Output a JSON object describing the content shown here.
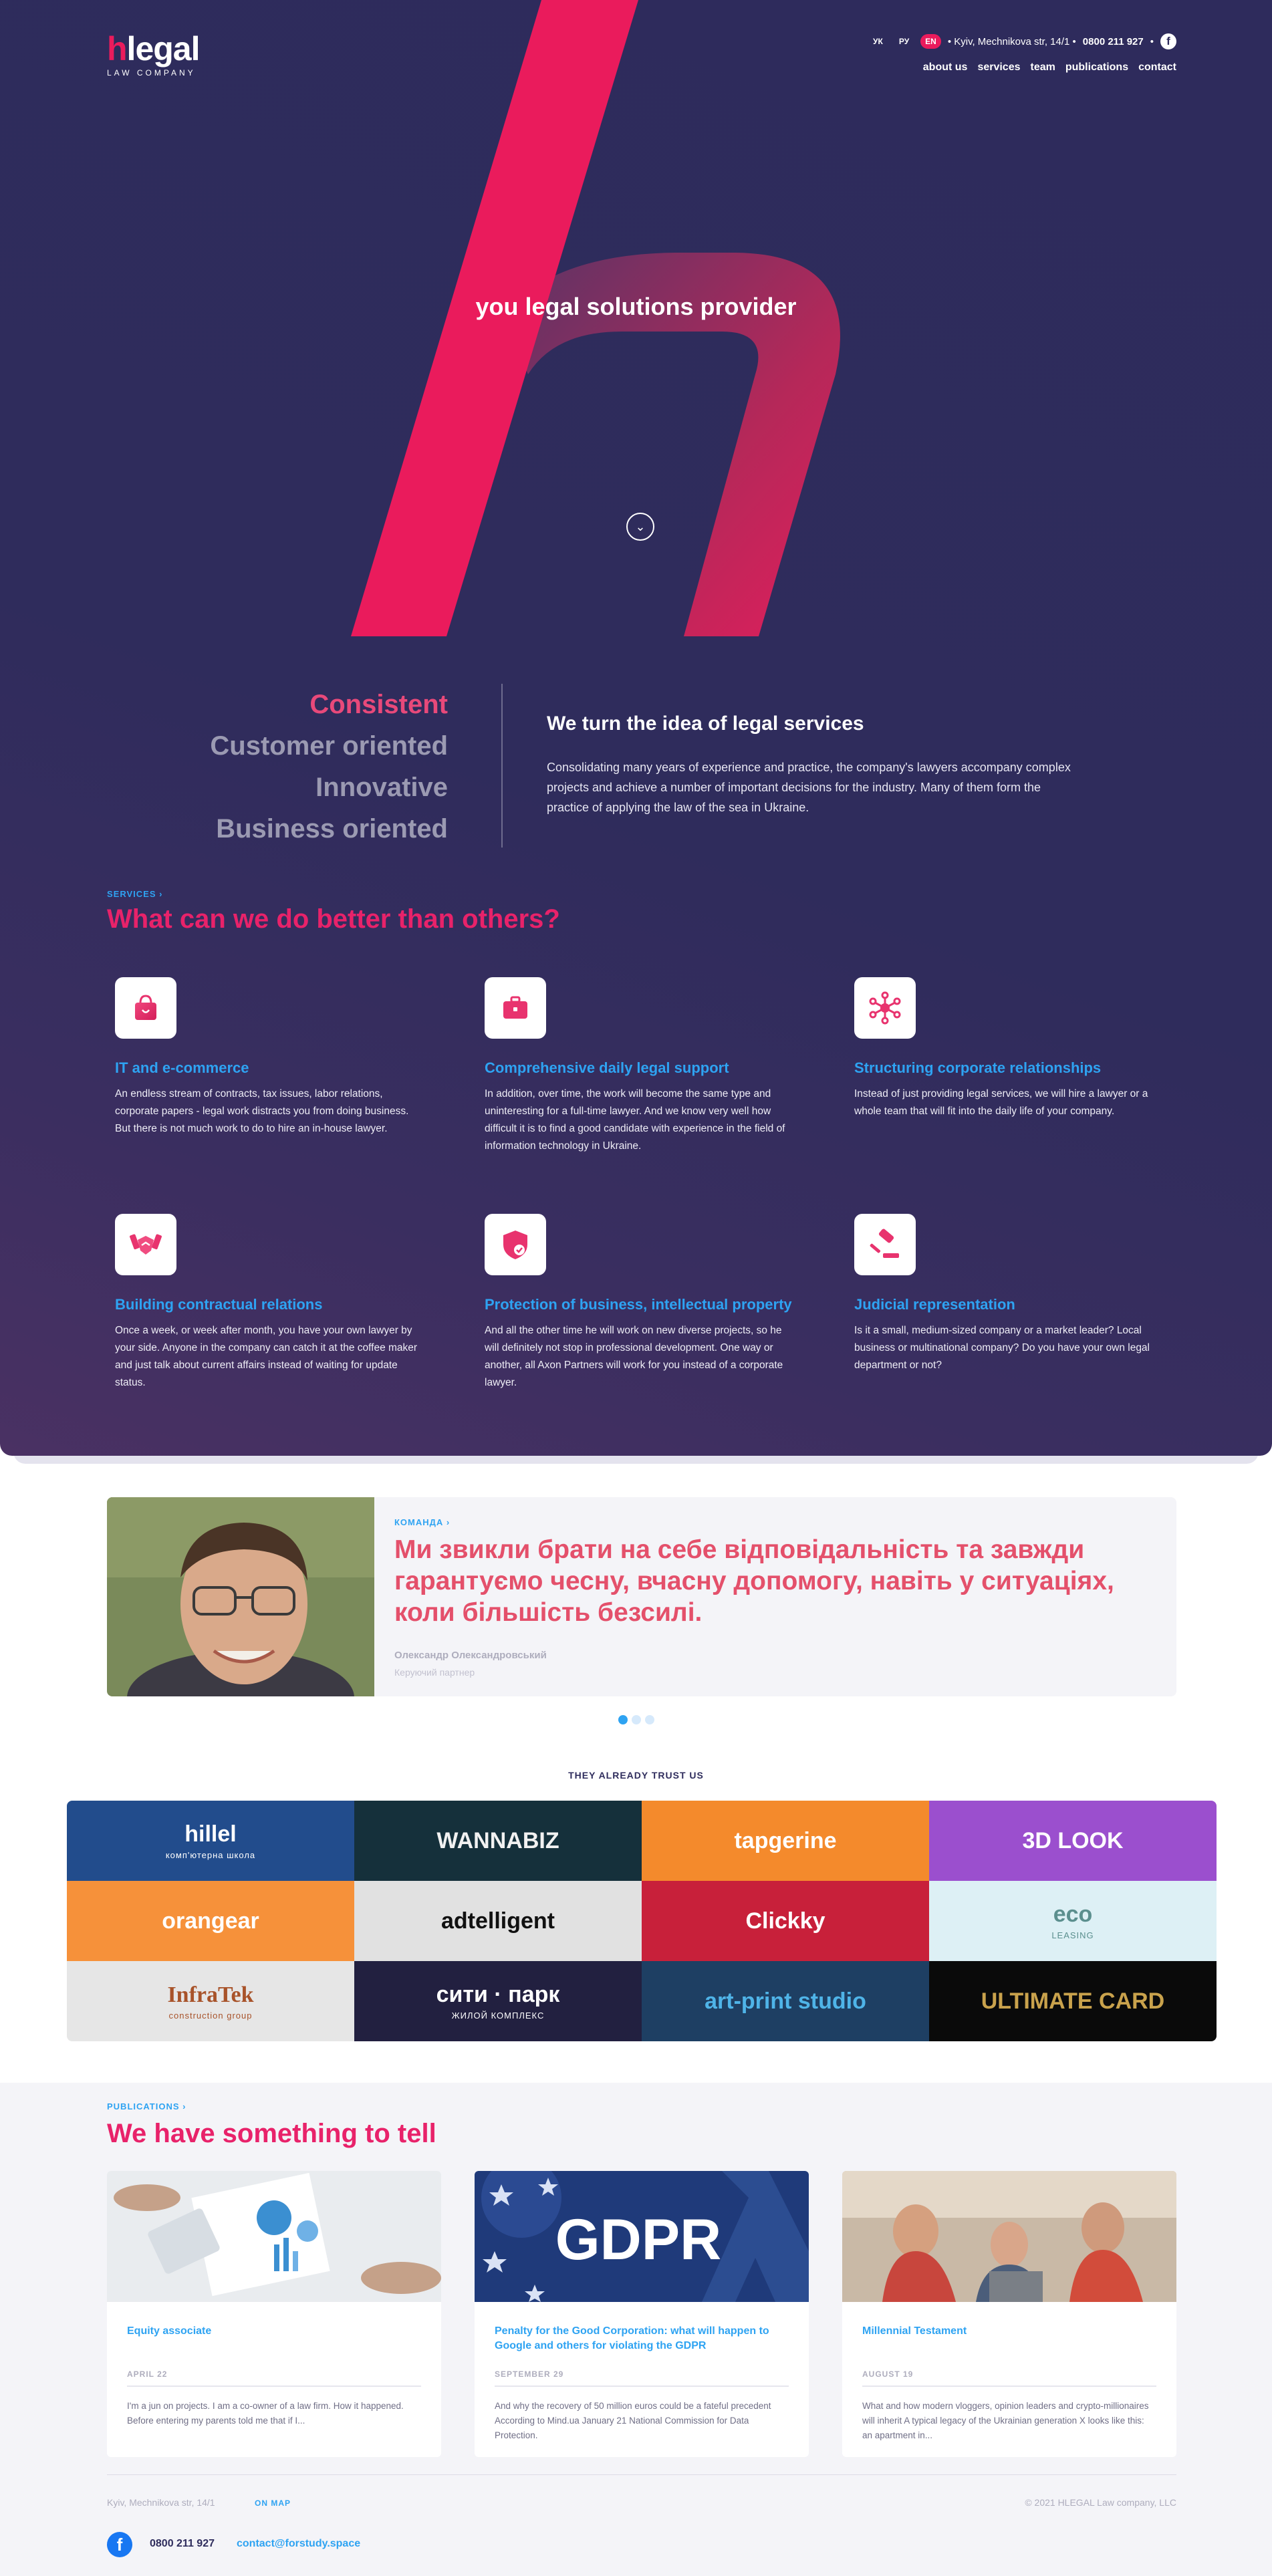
{
  "brand": {
    "logo_letter": "h",
    "logo_rest": "legal",
    "logo_sub": "LAW COMPANY",
    "accent": "#ea1b5c",
    "dark": "#2e2b5c",
    "link_blue": "#2ea3f2"
  },
  "topbar": {
    "languages": [
      "УК",
      "РУ",
      "EN"
    ],
    "active_language": "EN",
    "address": "• Kyiv, Mechnikova str, 14/1 •",
    "phone": "0800 211 927",
    "sep": "•",
    "fb_icon": "f"
  },
  "nav": [
    "about us",
    "services",
    "team",
    "publications",
    "contact"
  ],
  "hero": {
    "tagline": "you legal solutions provider",
    "scroll_icon": "⌄"
  },
  "values": [
    "Consistent",
    "Customer oriented",
    "Innovative",
    "Business oriented"
  ],
  "about": {
    "title": "We turn the idea of legal services",
    "text": "Consolidating many years of experience and practice, the company's lawyers accompany complex projects and achieve a number of important decisions for the industry. Many of them form the practice of applying the law of the sea in Ukraine."
  },
  "services": {
    "kicker": "SERVICES ›",
    "title": "What can we do better than others?",
    "items": [
      {
        "icon": "shopping-bag-icon",
        "title": "IT and e-commerce",
        "text": "An endless stream of contracts, tax issues, labor relations, corporate papers - legal work distracts you from doing business. But there is not much work to do to hire an in-house lawyer."
      },
      {
        "icon": "briefcase-icon",
        "title": "Comprehensive daily legal support",
        "text": "In addition, over time, the work will become the same type and uninteresting for a full-time lawyer. And we know very well how difficult it is to find a good candidate with experience in the field of information technology in Ukraine."
      },
      {
        "icon": "network-icon",
        "title": "Structuring corporate relationships",
        "text": "Instead of just providing legal services, we will hire a lawyer or a whole team that will fit into the daily life of your company."
      },
      {
        "icon": "handshake-icon",
        "title": "Building contractual relations",
        "text": "Once a week, or week after month, you have your own lawyer by your side. Anyone in the company can catch it at the coffee maker and just talk about current affairs instead of waiting for update status."
      },
      {
        "icon": "shield-icon",
        "title": "Protection of business, intellectual property",
        "text": "And all the other time he will work on new diverse projects, so he will definitely not stop in professional development. One way or another, all Axon Partners will work for you instead of a corporate lawyer."
      },
      {
        "icon": "gavel-icon",
        "title": "Judicial representation",
        "text": "Is it a small, medium-sized company or a market leader? Local business or multinational company? Do you have your own legal department or not?"
      }
    ]
  },
  "team": {
    "kicker": "КОМАНДА ›",
    "quote": "Ми звикли брати на себе відповідальність та завжди гарантуємо чесну, вчасну допомогу, навіть у ситуаціях, коли більшість безсилі.",
    "name": "Олександр Олександровський",
    "role": "Керуючий партнер",
    "slides": 3,
    "active_slide": 0
  },
  "clients": {
    "title": "THEY ALREADY TRUST US",
    "logos": [
      {
        "name": "hillel",
        "sub": "комп'ютерна школа",
        "bg": "#224c8c",
        "fg": "#ffffff"
      },
      {
        "name": "WANNABIZ",
        "sub": "",
        "bg": "#15303b",
        "fg": "#f1f1f1"
      },
      {
        "name": "tapgerine",
        "sub": "",
        "bg": "#f48a2c",
        "fg": "#ffffff"
      },
      {
        "name": "3D LOOK",
        "sub": "",
        "bg": "#9b4fce",
        "fg": "#ffffff"
      },
      {
        "name": "orangear",
        "sub": "",
        "bg": "#f6913a",
        "fg": "#ffffff"
      },
      {
        "name": "adtelligent",
        "sub": "",
        "bg": "#e1e1e1",
        "fg": "#111111"
      },
      {
        "name": "Clickky",
        "sub": "",
        "bg": "#c8203a",
        "fg": "#ffffff"
      },
      {
        "name": "eco",
        "sub": "LEASING",
        "bg": "#ddf0f5",
        "fg": "#5b8f8e"
      },
      {
        "name": "InfraTek",
        "sub": "construction group",
        "bg": "#e6e6e6",
        "fg": "#a8532a"
      },
      {
        "name": "сити · парк",
        "sub": "ЖИЛОЙ КОМПЛЕКС",
        "bg": "#222040",
        "fg": "#ffffff"
      },
      {
        "name": "art-print studio",
        "sub": "",
        "bg": "#1e3f63",
        "fg": "#4fb4e8"
      },
      {
        "name": "ULTIMATE CARD",
        "sub": "",
        "bg": "#0a0a0a",
        "fg": "#c9a24c"
      }
    ]
  },
  "publications": {
    "kicker": "PUBLICATIONS ›",
    "title": "We have something to tell",
    "posts": [
      {
        "title": "Equity associate",
        "date": "APRIL 22",
        "text": "I'm a jun on projects. I am a co-owner of a law firm. How it happened. Before entering my parents told me that if I..."
      },
      {
        "title": "Penalty for the Good Corporation: what will happen to Google and others for violating the GDPR",
        "date": "SEPTEMBER 29",
        "text": "And why the recovery of 50 million euros could be a fateful precedent According to Mind.ua January 21 National Commission for Data Protection.",
        "image_text": "GDPR"
      },
      {
        "title": "Millennial Testament",
        "date": "AUGUST 19",
        "text": "What and how modern vloggers, opinion leaders and crypto-millionaires will inherit A typical legacy of the Ukrainian generation X looks like this: an apartment in..."
      }
    ]
  },
  "footer": {
    "address": "Kyiv, Mechnikova str, 14/1",
    "map_link": "ON MAP",
    "copyright": "© 2021 HLEGAL Law company, LLC",
    "fb_icon": "f",
    "phone": "0800 211 927",
    "email": "contact@forstudy.space"
  }
}
